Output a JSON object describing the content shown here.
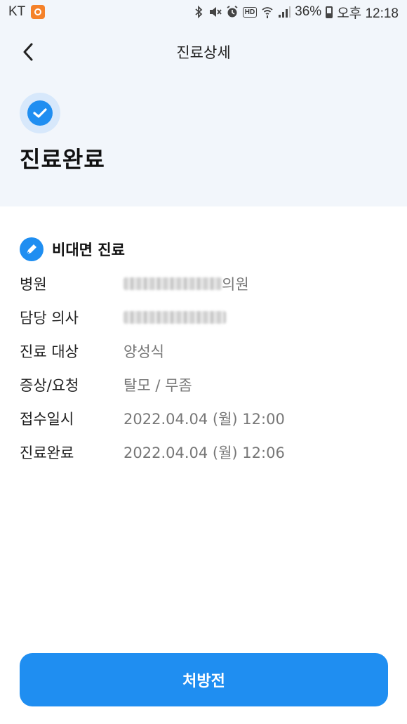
{
  "status_bar": {
    "carrier": "KT",
    "battery": "36%",
    "time": "오후 12:18",
    "icons": [
      "bluetooth-icon",
      "mute-icon",
      "alarm-icon",
      "hd-icon",
      "wifi-icon",
      "signal-icon",
      "battery-icon"
    ],
    "hd_label": "HD"
  },
  "header": {
    "title": "진료상세",
    "back_icon": "chevron-left-icon"
  },
  "status": {
    "title": "진료완료",
    "icon": "check-circle-icon"
  },
  "section": {
    "title": "비대면 진료",
    "icon": "pen-icon"
  },
  "details": {
    "hospital": {
      "label": "병원",
      "value_suffix": "의원"
    },
    "doctor": {
      "label": "담당 의사"
    },
    "patient": {
      "label": "진료 대상",
      "value": "양성식"
    },
    "symptoms": {
      "label": "증상/요청",
      "value": "탈모 / 무좀"
    },
    "received": {
      "label": "접수일시",
      "value": "2022.04.04 (월) 12:00"
    },
    "completed": {
      "label": "진료완료",
      "value": "2022.04.04 (월) 12:06"
    }
  },
  "footer": {
    "button_label": "처방전"
  },
  "colors": {
    "accent": "#1f8ef1",
    "top_background": "#f2f6fb"
  }
}
